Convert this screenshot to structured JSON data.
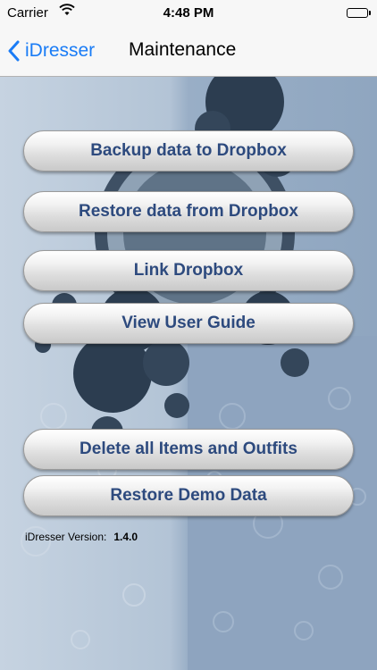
{
  "status_bar": {
    "carrier": "Carrier",
    "time": "4:48 PM"
  },
  "nav": {
    "back_label": "iDresser",
    "title": "Maintenance"
  },
  "buttons": {
    "backup": "Backup data to Dropbox",
    "restore": "Restore data from Dropbox",
    "link": "Link Dropbox",
    "guide": "View User Guide",
    "delete_all": "Delete all Items and Outfits",
    "restore_demo": "Restore Demo Data"
  },
  "version": {
    "label": "iDresser Version:",
    "value": "1.4.0"
  },
  "colors": {
    "nav_tint": "#1a7cf6",
    "button_text": "#2d4a7e"
  }
}
